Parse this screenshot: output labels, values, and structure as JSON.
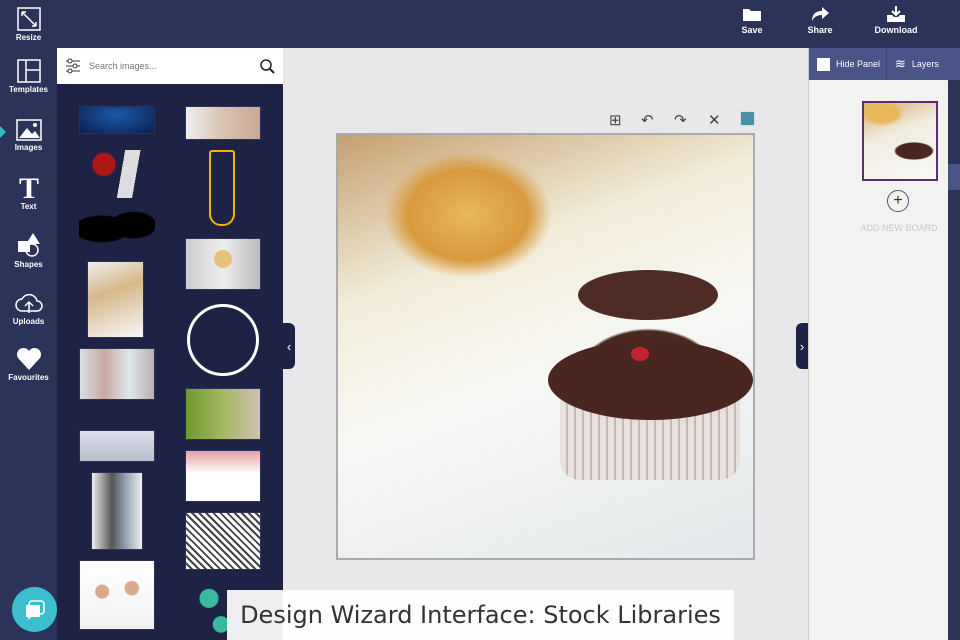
{
  "topbar": {
    "save": "Save",
    "share": "Share",
    "download": "Download"
  },
  "nav": {
    "resize": "Resize",
    "templates": "Templates",
    "images": "Images",
    "text": "Text",
    "shapes": "Shapes",
    "uploads": "Uploads",
    "favourites": "Favourites",
    "active": "Images"
  },
  "search": {
    "placeholder": "Search images..."
  },
  "canvas": {
    "swatch_color": "#4b90a6"
  },
  "right_panel": {
    "hide_panel": "Hide Panel",
    "layers": "Layers",
    "add_new_board": "ADD NEW BOARD"
  },
  "caption": "Design Wizard Interface: Stock Libraries"
}
